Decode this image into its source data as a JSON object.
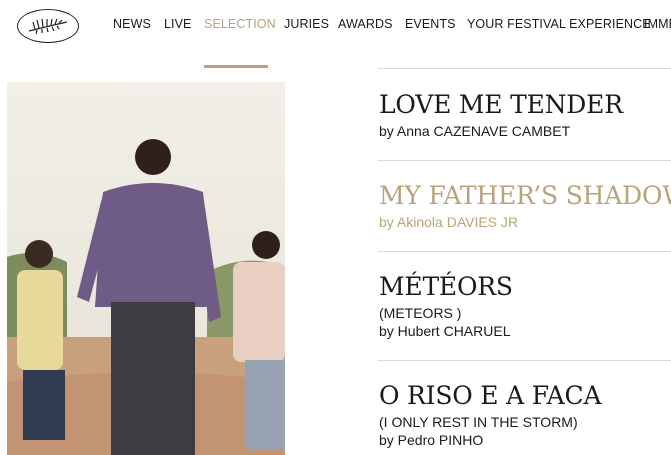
{
  "header": {
    "logo_icon": "palm-leaf-icon",
    "nav": [
      {
        "label": "NEWS"
      },
      {
        "label": "LIVE"
      },
      {
        "label": "SELECTION",
        "active": true
      },
      {
        "label": "JURIES"
      },
      {
        "label": "AWARDS"
      },
      {
        "label": "EVENTS"
      },
      {
        "label": "YOUR FESTIVAL EXPERIENCE"
      },
      {
        "label": "IMME"
      }
    ],
    "accent_color": "#b8a37a"
  },
  "films": [
    {
      "title": "LOVE ME TENDER",
      "director": "by Anna CAZENAVE CAMBET"
    },
    {
      "title": "MY FATHER’S SHADOW",
      "director": "by Akinola DAVIES JR",
      "highlighted": true
    },
    {
      "title": "MÉTÉORS",
      "alt_title": "(METEORS )",
      "director": "by Hubert CHARUEL"
    },
    {
      "title": "O RISO E A FACA",
      "alt_title": "(I ONLY REST IN THE STORM)",
      "director": "by Pedro PINHO"
    }
  ]
}
